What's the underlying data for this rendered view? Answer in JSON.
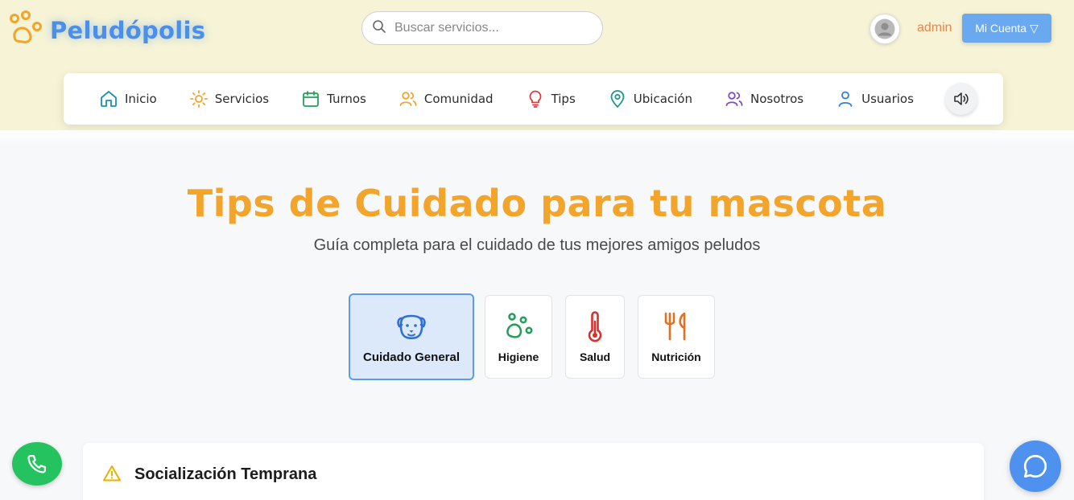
{
  "header": {
    "logo_text": "Peludópolis",
    "search_placeholder": "Buscar servicios...",
    "username": "admin",
    "account_button": "Mi Cuenta ▽"
  },
  "nav": {
    "items": [
      {
        "label": "Inicio",
        "icon": "home-icon",
        "color": "#1a8fb5"
      },
      {
        "label": "Servicios",
        "icon": "sun-icon",
        "color": "#f3a42b"
      },
      {
        "label": "Turnos",
        "icon": "calendar-icon",
        "color": "#22a05a"
      },
      {
        "label": "Comunidad",
        "icon": "users-icon",
        "color": "#f3a42b"
      },
      {
        "label": "Tips",
        "icon": "lightbulb-icon",
        "color": "#e0353b"
      },
      {
        "label": "Ubicación",
        "icon": "map-pin-icon",
        "color": "#1a9a8a"
      },
      {
        "label": "Nosotros",
        "icon": "users-icon",
        "color": "#7b4fc4"
      },
      {
        "label": "Usuarios",
        "icon": "user-icon",
        "color": "#2e7ee0"
      }
    ],
    "sound_icon": "speaker-icon"
  },
  "hero": {
    "title": "Tips de Cuidado para tu mascota",
    "subtitle": "Guía completa para el cuidado de tus mejores amigos peludos"
  },
  "categories": [
    {
      "label": "Cuidado General",
      "icon": "dog-icon",
      "color": "#2e6fd6",
      "active": true
    },
    {
      "label": "Higiene",
      "icon": "paw-icon",
      "color": "#22a05a",
      "active": false
    },
    {
      "label": "Salud",
      "icon": "thermometer-icon",
      "color": "#d9302c",
      "active": false
    },
    {
      "label": "Nutrición",
      "icon": "utensils-icon",
      "color": "#e2711f",
      "active": false
    }
  ],
  "card": {
    "title": "Socialización Temprana",
    "icon": "warning-icon"
  },
  "fabs": {
    "phone_icon": "phone-icon",
    "chat_icon": "chat-icon"
  },
  "colors": {
    "brand": "#4a8fe9",
    "accent": "#f3a42b",
    "header_bg": "#f6f3d6"
  }
}
